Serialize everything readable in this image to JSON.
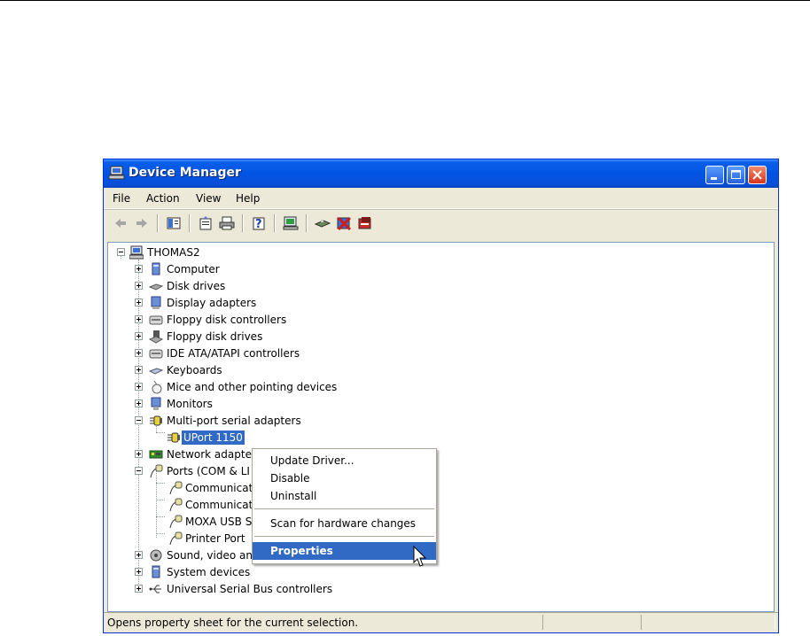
{
  "window": {
    "title": "Device Manager"
  },
  "menubar": {
    "items": [
      "File",
      "Action",
      "View",
      "Help"
    ]
  },
  "toolbar": {
    "icons": [
      "back-arrow-icon",
      "forward-arrow-icon",
      "console-tree-icon",
      "properties-icon",
      "print-icon",
      "help-icon",
      "scan-hardware-icon",
      "update-driver-icon",
      "disable-device-icon",
      "uninstall-device-icon"
    ]
  },
  "tree": {
    "root": "THOMAS2",
    "items": [
      "Computer",
      "Disk drives",
      "Display adapters",
      "Floppy disk controllers",
      "Floppy disk drives",
      "IDE ATA/ATAPI controllers",
      "Keyboards",
      "Mice and other pointing devices",
      "Monitors",
      "Multi-port serial adapters",
      "UPort 1150",
      "Network adapte",
      "Ports (COM & LI",
      "Communicat",
      "Communicat",
      "MOXA USB S",
      "Printer Port",
      "Sound, video and game controllers",
      "System devices",
      "Universal Serial Bus controllers"
    ]
  },
  "context_menu": {
    "items": [
      "Update Driver...",
      "Disable",
      "Uninstall",
      "Scan for hardware changes",
      "Properties"
    ],
    "highlighted": "Properties"
  },
  "status": {
    "text": "Opens property sheet for the current selection."
  },
  "colors": {
    "titlebar": "#0054E3",
    "selection": "#316AC5",
    "chrome": "#ECE9D8"
  }
}
